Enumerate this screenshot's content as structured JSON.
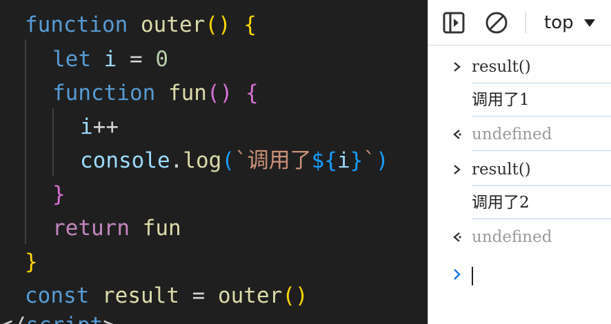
{
  "editor": {
    "lines": [
      {
        "t1": "function",
        "t2": " ",
        "t3": "outer",
        "t4": "()",
        "t5": " ",
        "t6": "{"
      },
      {
        "t1": "let",
        "t2": " ",
        "t3": "i",
        "t4": " = ",
        "t5": "0"
      },
      {
        "t1": "function",
        "t2": " ",
        "t3": "fun",
        "t4": "()",
        "t5": " ",
        "t6": "{"
      },
      {
        "t1": "i",
        "t2": "++"
      },
      {
        "t1": "console",
        "t2": ".",
        "t3": "log",
        "t4": "(",
        "t5": "`调用了",
        "t6": "${",
        "t7": "i",
        "t8": "}",
        "t9": "`",
        "t10": ")"
      },
      {
        "t1": "}"
      },
      {
        "t1": "return",
        "t2": " ",
        "t3": "fun"
      },
      {
        "t1": "}"
      },
      {
        "t1": "const",
        "t2": " ",
        "t3": "result",
        "t4": " = ",
        "t5": "outer",
        "t6": "()"
      },
      {
        "t1": "</",
        "t2": "script",
        "t3": ">"
      }
    ]
  },
  "console": {
    "toolbar": {
      "sidebar_icon": "sidebar-toggle-icon",
      "clear_icon": "clear-console-icon",
      "context_label": "top",
      "context_arrow": "triangle-down-icon"
    },
    "messages": [
      {
        "kind": "command",
        "text": "result()"
      },
      {
        "kind": "output",
        "text": "调用了1"
      },
      {
        "kind": "return",
        "text": "undefined"
      },
      {
        "kind": "command",
        "text": "result()"
      },
      {
        "kind": "output",
        "text": "调用了2"
      },
      {
        "kind": "return",
        "text": "undefined"
      }
    ],
    "prompt_icon": "chevron-right-icon",
    "colors": {
      "prompt_blue": "#1a73e8",
      "separator": "#bcd3ef",
      "return_gray": "#9a9a9a"
    }
  }
}
